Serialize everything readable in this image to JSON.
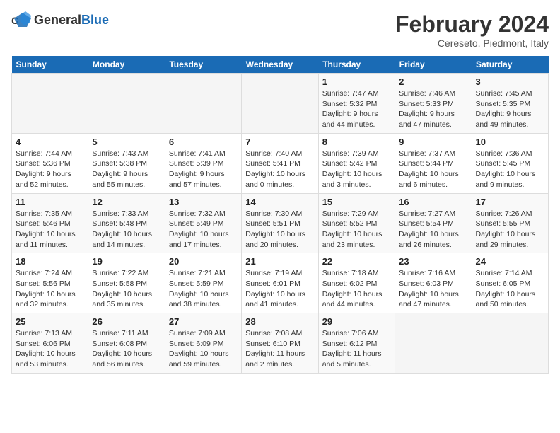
{
  "logo": {
    "text_general": "General",
    "text_blue": "Blue"
  },
  "title": "February 2024",
  "subtitle": "Cereseto, Piedmont, Italy",
  "days_of_week": [
    "Sunday",
    "Monday",
    "Tuesday",
    "Wednesday",
    "Thursday",
    "Friday",
    "Saturday"
  ],
  "weeks": [
    [
      {
        "day": "",
        "info": ""
      },
      {
        "day": "",
        "info": ""
      },
      {
        "day": "",
        "info": ""
      },
      {
        "day": "",
        "info": ""
      },
      {
        "day": "1",
        "info": "Sunrise: 7:47 AM\nSunset: 5:32 PM\nDaylight: 9 hours\nand 44 minutes."
      },
      {
        "day": "2",
        "info": "Sunrise: 7:46 AM\nSunset: 5:33 PM\nDaylight: 9 hours\nand 47 minutes."
      },
      {
        "day": "3",
        "info": "Sunrise: 7:45 AM\nSunset: 5:35 PM\nDaylight: 9 hours\nand 49 minutes."
      }
    ],
    [
      {
        "day": "4",
        "info": "Sunrise: 7:44 AM\nSunset: 5:36 PM\nDaylight: 9 hours\nand 52 minutes."
      },
      {
        "day": "5",
        "info": "Sunrise: 7:43 AM\nSunset: 5:38 PM\nDaylight: 9 hours\nand 55 minutes."
      },
      {
        "day": "6",
        "info": "Sunrise: 7:41 AM\nSunset: 5:39 PM\nDaylight: 9 hours\nand 57 minutes."
      },
      {
        "day": "7",
        "info": "Sunrise: 7:40 AM\nSunset: 5:41 PM\nDaylight: 10 hours\nand 0 minutes."
      },
      {
        "day": "8",
        "info": "Sunrise: 7:39 AM\nSunset: 5:42 PM\nDaylight: 10 hours\nand 3 minutes."
      },
      {
        "day": "9",
        "info": "Sunrise: 7:37 AM\nSunset: 5:44 PM\nDaylight: 10 hours\nand 6 minutes."
      },
      {
        "day": "10",
        "info": "Sunrise: 7:36 AM\nSunset: 5:45 PM\nDaylight: 10 hours\nand 9 minutes."
      }
    ],
    [
      {
        "day": "11",
        "info": "Sunrise: 7:35 AM\nSunset: 5:46 PM\nDaylight: 10 hours\nand 11 minutes."
      },
      {
        "day": "12",
        "info": "Sunrise: 7:33 AM\nSunset: 5:48 PM\nDaylight: 10 hours\nand 14 minutes."
      },
      {
        "day": "13",
        "info": "Sunrise: 7:32 AM\nSunset: 5:49 PM\nDaylight: 10 hours\nand 17 minutes."
      },
      {
        "day": "14",
        "info": "Sunrise: 7:30 AM\nSunset: 5:51 PM\nDaylight: 10 hours\nand 20 minutes."
      },
      {
        "day": "15",
        "info": "Sunrise: 7:29 AM\nSunset: 5:52 PM\nDaylight: 10 hours\nand 23 minutes."
      },
      {
        "day": "16",
        "info": "Sunrise: 7:27 AM\nSunset: 5:54 PM\nDaylight: 10 hours\nand 26 minutes."
      },
      {
        "day": "17",
        "info": "Sunrise: 7:26 AM\nSunset: 5:55 PM\nDaylight: 10 hours\nand 29 minutes."
      }
    ],
    [
      {
        "day": "18",
        "info": "Sunrise: 7:24 AM\nSunset: 5:56 PM\nDaylight: 10 hours\nand 32 minutes."
      },
      {
        "day": "19",
        "info": "Sunrise: 7:22 AM\nSunset: 5:58 PM\nDaylight: 10 hours\nand 35 minutes."
      },
      {
        "day": "20",
        "info": "Sunrise: 7:21 AM\nSunset: 5:59 PM\nDaylight: 10 hours\nand 38 minutes."
      },
      {
        "day": "21",
        "info": "Sunrise: 7:19 AM\nSunset: 6:01 PM\nDaylight: 10 hours\nand 41 minutes."
      },
      {
        "day": "22",
        "info": "Sunrise: 7:18 AM\nSunset: 6:02 PM\nDaylight: 10 hours\nand 44 minutes."
      },
      {
        "day": "23",
        "info": "Sunrise: 7:16 AM\nSunset: 6:03 PM\nDaylight: 10 hours\nand 47 minutes."
      },
      {
        "day": "24",
        "info": "Sunrise: 7:14 AM\nSunset: 6:05 PM\nDaylight: 10 hours\nand 50 minutes."
      }
    ],
    [
      {
        "day": "25",
        "info": "Sunrise: 7:13 AM\nSunset: 6:06 PM\nDaylight: 10 hours\nand 53 minutes."
      },
      {
        "day": "26",
        "info": "Sunrise: 7:11 AM\nSunset: 6:08 PM\nDaylight: 10 hours\nand 56 minutes."
      },
      {
        "day": "27",
        "info": "Sunrise: 7:09 AM\nSunset: 6:09 PM\nDaylight: 10 hours\nand 59 minutes."
      },
      {
        "day": "28",
        "info": "Sunrise: 7:08 AM\nSunset: 6:10 PM\nDaylight: 11 hours\nand 2 minutes."
      },
      {
        "day": "29",
        "info": "Sunrise: 7:06 AM\nSunset: 6:12 PM\nDaylight: 11 hours\nand 5 minutes."
      },
      {
        "day": "",
        "info": ""
      },
      {
        "day": "",
        "info": ""
      }
    ]
  ]
}
